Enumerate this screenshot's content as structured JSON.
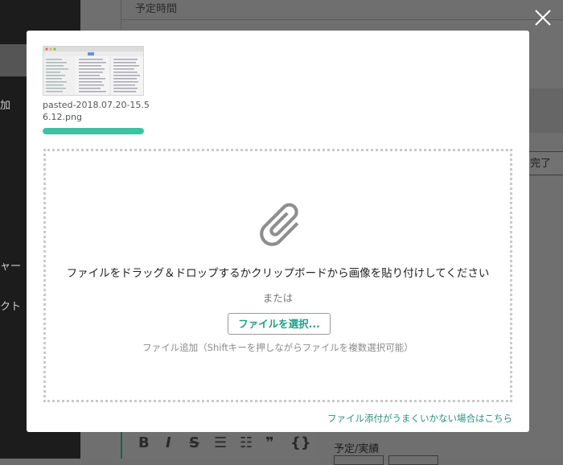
{
  "background": {
    "header_field_label": "予定時間",
    "sidebar_texts": [
      "加",
      "ャー",
      "クト",
      ""
    ],
    "done_button": "完了",
    "toolbar_icons": [
      "B",
      "I",
      "S",
      "☰",
      "☷",
      "❞",
      "{}"
    ],
    "schedule_label": "予定/実績"
  },
  "modal": {
    "attachment": {
      "file_name": "pasted-2018.07.20-15.56.12.png",
      "upload_progress_percent": 100
    },
    "drop_instruction": "ファイルをドラッグ＆ドロップするかクリップボードから画像を貼り付けしてください",
    "or_text": "または",
    "select_file_button": "ファイルを選択...",
    "add_hint": "ファイル追加（Shiftキーを押しながらファイルを複数選択可能）",
    "help_link": "ファイル添付がうまくいかない場合はこちら"
  },
  "icons": {
    "close": "close-icon",
    "drop": "paperclip-icon"
  },
  "colors": {
    "accent": "#3cc3a4",
    "button_text": "#219e87",
    "overlay": "#6e6e6e"
  }
}
